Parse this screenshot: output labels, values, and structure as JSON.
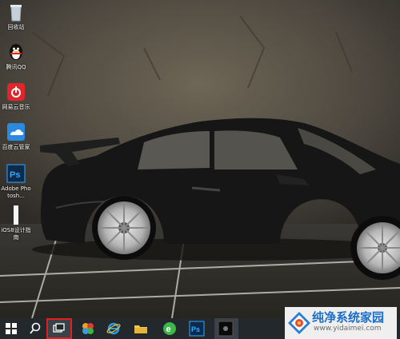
{
  "desktop": {
    "icons": [
      {
        "label": "回收站",
        "icon": "recycle-bin-icon"
      },
      {
        "label": "腾讯QQ",
        "icon": "qq-penguin-icon"
      },
      {
        "label": "网易云音乐",
        "icon": "netease-music-icon"
      },
      {
        "label": "百度云管家",
        "icon": "baidu-cloud-icon"
      },
      {
        "label": "Adobe Photosh...",
        "icon": "photoshop-icon"
      },
      {
        "label": "iOS8设计指南",
        "icon": "document-icon"
      }
    ]
  },
  "taskbar": {
    "items": [
      {
        "name": "start",
        "icon": "windows-logo-icon"
      },
      {
        "name": "search",
        "icon": "search-icon"
      },
      {
        "name": "task-view",
        "icon": "task-view-icon",
        "active": true
      },
      {
        "name": "colorful-app",
        "icon": "colorful-flower-icon"
      },
      {
        "name": "internet-explorer",
        "icon": "ie-icon"
      },
      {
        "name": "file-explorer",
        "icon": "folder-icon"
      },
      {
        "name": "browser-360",
        "icon": "green-e-browser-icon"
      },
      {
        "name": "photoshop",
        "icon": "photoshop-icon"
      },
      {
        "name": "app-window",
        "icon": "dark-window-icon"
      }
    ],
    "highlight_color": "#e02020"
  },
  "watermark": {
    "title": "纯净系统家园",
    "url": "www.yidaimei.com"
  },
  "colors": {
    "taskbar": "#23282d",
    "photoshop_bg": "#0d2a4a",
    "photoshop_text": "#31a8ff",
    "watermark_blue": "#1b6fc8"
  }
}
